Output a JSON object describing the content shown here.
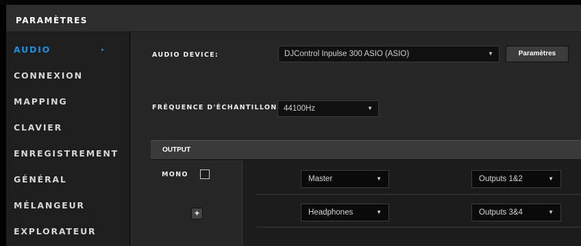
{
  "header": {
    "title": "PARAMÈTRES"
  },
  "sidebar": {
    "items": [
      {
        "label": "AUDIO"
      },
      {
        "label": "CONNEXION"
      },
      {
        "label": "MAPPING"
      },
      {
        "label": "CLAVIER"
      },
      {
        "label": "ENREGISTREMENT"
      },
      {
        "label": "GÉNÉRAL"
      },
      {
        "label": "MÉLANGEUR"
      },
      {
        "label": "EXPLORATEUR"
      }
    ],
    "active_arrow": "▸"
  },
  "audio": {
    "device_label": "AUDIO DEVICE:",
    "device_value": "DJControl Inpulse 300 ASIO (ASIO)",
    "settings_button": "Paramètres",
    "samplerate_label": "FRÉQUENCE D'ÉCHANTILLONN",
    "samplerate_value": "44100Hz",
    "caret": "▼"
  },
  "output": {
    "title": "OUTPUT",
    "mono_label": "MONO",
    "mono_checked": false,
    "add_button": "+",
    "rows": [
      {
        "source": "Master",
        "target": "Outputs 1&2"
      },
      {
        "source": "Headphones",
        "target": "Outputs 3&4"
      }
    ]
  },
  "colors": {
    "accent": "#1f8fe0",
    "sidebar_bg": "#1e1e1e",
    "main_bg": "#262626",
    "header_bg": "#2d2d2d"
  }
}
